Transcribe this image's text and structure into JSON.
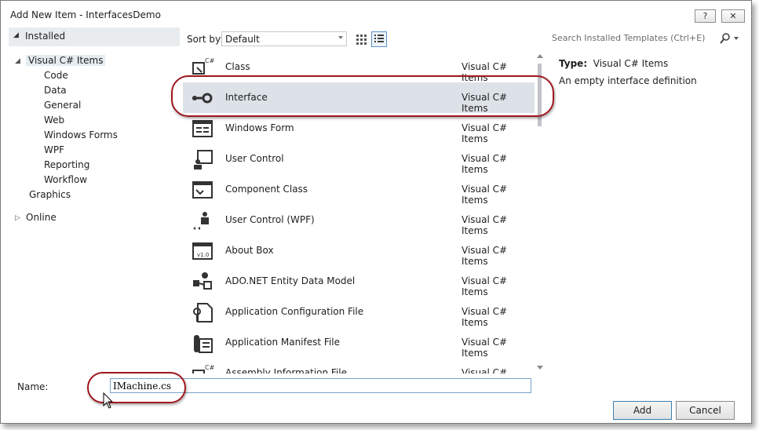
{
  "window": {
    "title": "Add New Item - InterfacesDemo",
    "help_label": "?",
    "close_label": "✕"
  },
  "left": {
    "installed_label": "Installed",
    "tree": [
      {
        "label": "Visual C# Items",
        "level": 0,
        "expanded": true,
        "selected": true
      },
      {
        "label": "Code",
        "level": 1
      },
      {
        "label": "Data",
        "level": 1
      },
      {
        "label": "General",
        "level": 1
      },
      {
        "label": "Web",
        "level": 1
      },
      {
        "label": "Windows Forms",
        "level": 1
      },
      {
        "label": "WPF",
        "level": 1
      },
      {
        "label": "Reporting",
        "level": 1
      },
      {
        "label": "Workflow",
        "level": 1
      },
      {
        "label": "Graphics",
        "level": 0
      }
    ],
    "online_label": "Online"
  },
  "toolbar": {
    "sort_label": "Sort by:",
    "sort_value": "Default"
  },
  "templates": [
    {
      "name": "Class",
      "lang": "Visual C# Items",
      "icon": "class-icon"
    },
    {
      "name": "Interface",
      "lang": "Visual C# Items",
      "icon": "interface-icon",
      "selected": true
    },
    {
      "name": "Windows Form",
      "lang": "Visual C# Items",
      "icon": "windows-form-icon"
    },
    {
      "name": "User Control",
      "lang": "Visual C# Items",
      "icon": "user-control-icon"
    },
    {
      "name": "Component Class",
      "lang": "Visual C# Items",
      "icon": "component-class-icon"
    },
    {
      "name": "User Control (WPF)",
      "lang": "Visual C# Items",
      "icon": "wpf-user-control-icon"
    },
    {
      "name": "About Box",
      "lang": "Visual C# Items",
      "icon": "about-box-icon"
    },
    {
      "name": "ADO.NET Entity Data Model",
      "lang": "Visual C# Items",
      "icon": "entity-model-icon"
    },
    {
      "name": "Application Configuration File",
      "lang": "Visual C# Items",
      "icon": "config-file-icon"
    },
    {
      "name": "Application Manifest File",
      "lang": "Visual C# Items",
      "icon": "manifest-file-icon"
    },
    {
      "name": "Assembly Information File",
      "lang": "Visual C# Items",
      "icon": "assembly-info-icon"
    }
  ],
  "search": {
    "placeholder": "Search Installed Templates (Ctrl+E)"
  },
  "details": {
    "type_label": "Type:",
    "type_value": "Visual C# Items",
    "description": "An empty interface definition"
  },
  "name_field": {
    "label": "Name:",
    "value": "IMachine.cs"
  },
  "buttons": {
    "add": "Add",
    "cancel": "Cancel"
  },
  "colors": {
    "callout": "#a0171e",
    "selection": "#dde2e8",
    "accent": "#3c7fb1"
  }
}
